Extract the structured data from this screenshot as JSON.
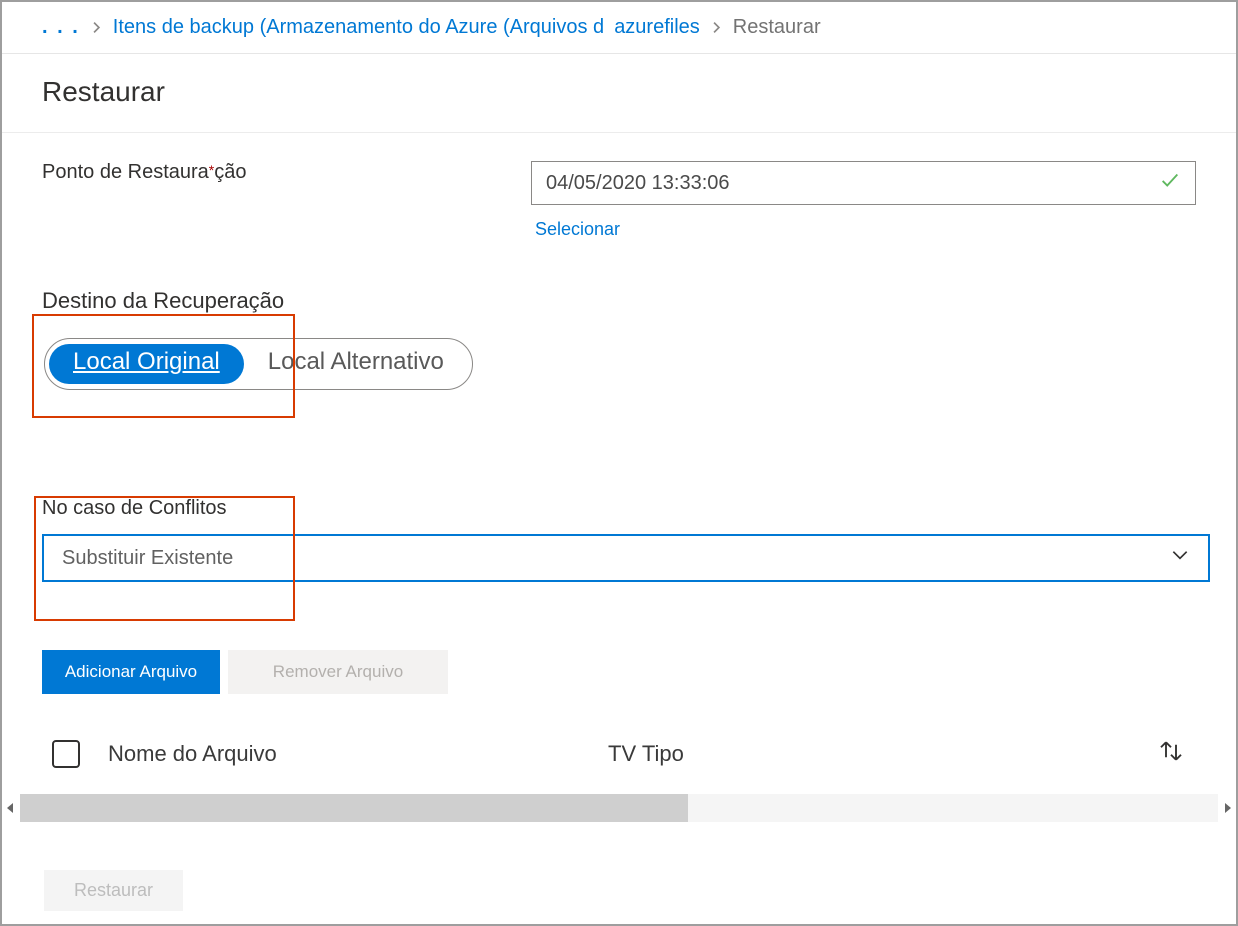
{
  "breadcrumb": {
    "ellipsis": ". . .",
    "link1": "Itens de backup (Armazenamento do Azure (Arquivos d",
    "link2": "azurefiles",
    "current": "Restaurar"
  },
  "page_title": "Restaurar",
  "restore_point": {
    "label_pre": "Ponto de Restaura",
    "label_post": "ção",
    "value": "04/05/2020 13:33:06",
    "select_link": "Selecionar"
  },
  "recovery_dest": {
    "title": "Destino da Recuperação",
    "option_original": "Local Original",
    "option_alt": "Local Alternativo"
  },
  "conflicts": {
    "label": "No caso de Conflitos",
    "selected": "Substituir Existente"
  },
  "buttons": {
    "add_file": "Adicionar Arquivo",
    "remove_file": "Remover Arquivo",
    "restore": "Restaurar"
  },
  "table": {
    "col_name": "Nome do Arquivo",
    "col_type": "TV Tipo"
  }
}
